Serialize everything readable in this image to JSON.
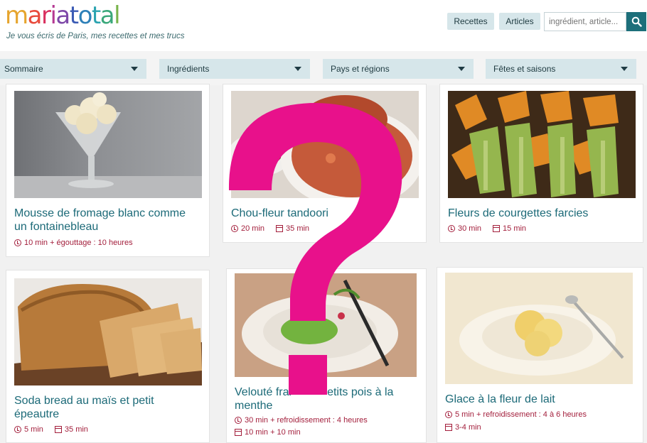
{
  "header": {
    "logo_parts": [
      {
        "text": "m",
        "color": "#e6a52e"
      },
      {
        "text": "a",
        "color": "#e84a3c"
      },
      {
        "text": "r",
        "color": "#d9305f"
      },
      {
        "text": "i",
        "color": "#b43892"
      },
      {
        "text": "a",
        "color": "#7e48a8"
      },
      {
        "text": "t",
        "color": "#3a5ab4"
      },
      {
        "text": "o",
        "color": "#2e80b8"
      },
      {
        "text": "t",
        "color": "#2aa3b0"
      },
      {
        "text": "a",
        "color": "#3aa87a"
      },
      {
        "text": "l",
        "color": "#78b34a"
      }
    ],
    "tagline": "Je vous écris de Paris, mes recettes et mes trucs",
    "nav": {
      "recettes": "Recettes",
      "articles": "Articles"
    },
    "search": {
      "placeholder": "ingrédient, article..."
    }
  },
  "filters": [
    "Sommaire",
    "Ingrédients",
    "Pays et régions",
    "Fêtes et saisons"
  ],
  "cards": [
    {
      "title_lines": [
        "Mousse de fromage blanc comme",
        "un fontainebleau"
      ],
      "prep": "10 min + égouttage : 10 heures",
      "cook": ""
    },
    {
      "title_lines": [
        "Chou-fleur tandoori"
      ],
      "prep": "20 min",
      "cook": "35 min"
    },
    {
      "title_lines": [
        "Fleurs de courgettes farcies"
      ],
      "prep": "30 min",
      "cook": "15 min"
    },
    {
      "title_lines": [
        "Soda bread au maïs et petit",
        "épeautre"
      ],
      "prep": "5 min",
      "cook": "35 min"
    },
    {
      "title_lines": [
        "Velouté frai",
        "menthe"
      ],
      "title_tail": "etits pois à la",
      "prep": "30 min + refroidissement : 4 heures",
      "cook": "10 min + 10 min"
    },
    {
      "title_lines": [
        "Glace à la fleur de lait"
      ],
      "prep": "5 min + refroidissement : 4 à 6 heures",
      "cook": "3-4 min"
    }
  ],
  "colors": {
    "accent": "#1d6f7a",
    "title": "#1c6a78",
    "meta": "#a31f3c",
    "overlay": "#e8118b"
  },
  "icons": {
    "search": "search-icon",
    "caret": "chevron-down-icon",
    "prep": "clock-icon",
    "cook": "oven-icon",
    "overlay": "question-mark-icon"
  }
}
